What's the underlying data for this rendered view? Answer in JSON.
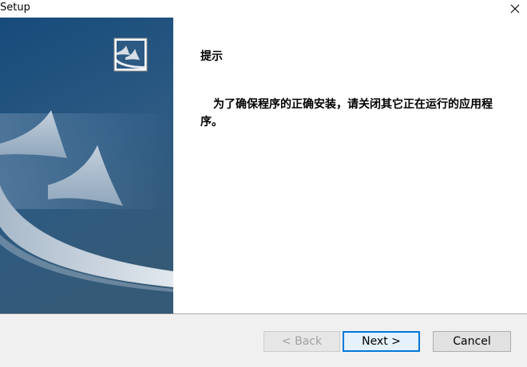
{
  "window": {
    "title": "Setup",
    "close_icon": "close-icon"
  },
  "art": {
    "logo_icon": "sail-logo-icon",
    "colors": {
      "panel_top": "#1a4f7e",
      "panel_bottom": "#2e5578",
      "swoosh": "#c9d5df"
    }
  },
  "content": {
    "heading": "提示",
    "message": "为了确保程序的正确安装，请关闭其它正在运行的应用程序。"
  },
  "footer": {
    "back_label": "< Back",
    "next_label": "Next >",
    "cancel_label": "Cancel",
    "back_enabled": false
  },
  "colors": {
    "accent": "#0078d7",
    "footer_bg": "#f0f0f0"
  }
}
